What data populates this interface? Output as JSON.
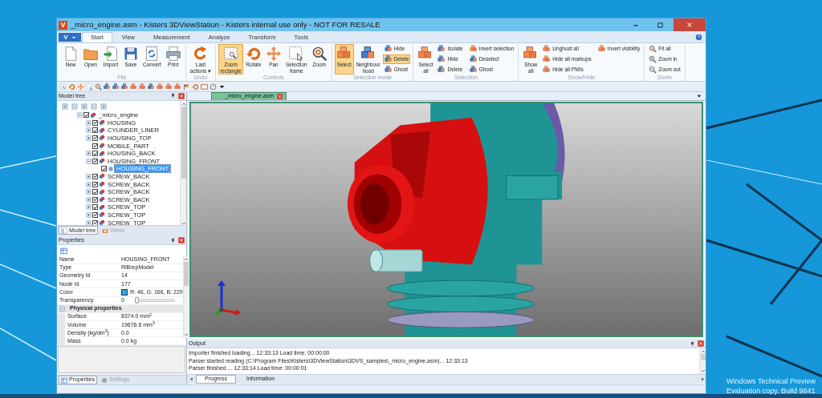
{
  "window": {
    "logo": "V",
    "title": "_micro_engine.asm - Kisters 3DViewStation - Kisters internal use only - NOT FOR RESALE"
  },
  "ribbon": {
    "app_button": "V",
    "tabs": [
      {
        "label": "Start",
        "selected": true
      },
      {
        "label": "View",
        "selected": false
      },
      {
        "label": "Measurement",
        "selected": false
      },
      {
        "label": "Analyze",
        "selected": false
      },
      {
        "label": "Transform",
        "selected": false
      },
      {
        "label": "Tools",
        "selected": false
      }
    ],
    "groups": [
      {
        "label": "File",
        "buttons": [
          {
            "label": "New",
            "kind": "large",
            "selected": false
          },
          {
            "label": "Open",
            "kind": "large",
            "selected": false
          },
          {
            "label": "Import",
            "kind": "large",
            "selected": false
          },
          {
            "label": "Save",
            "kind": "large",
            "selected": false
          },
          {
            "label": "Convert",
            "kind": "large",
            "selected": false
          },
          {
            "label": "Print",
            "kind": "large",
            "selected": false
          }
        ]
      },
      {
        "label": "Undo",
        "buttons": [
          {
            "label": "Last\nactions ▾",
            "kind": "large",
            "selected": false
          }
        ]
      },
      {
        "label": "Controls",
        "buttons": [
          {
            "label": "Zoom\nrectangle",
            "kind": "large",
            "selected": true
          },
          {
            "label": "Rotate",
            "kind": "large",
            "selected": false
          },
          {
            "label": "Pan",
            "kind": "large",
            "selected": false
          },
          {
            "label": "Selection\nframe",
            "kind": "large",
            "selected": false
          },
          {
            "label": "Zoom",
            "kind": "large",
            "selected": false
          }
        ]
      },
      {
        "label": "Selection mode",
        "buttons": [
          {
            "label": "Select",
            "kind": "large",
            "selected": true
          },
          {
            "label": "Neighbour\nhood",
            "kind": "large",
            "selected": false
          },
          {
            "label": "Hide",
            "kind": "small",
            "selected": false
          },
          {
            "label": "Delete",
            "kind": "small",
            "selected": true
          },
          {
            "label": "Ghost",
            "kind": "small",
            "selected": false
          }
        ]
      },
      {
        "label": "Selection",
        "buttons": [
          {
            "label": "Select\nall",
            "kind": "large",
            "selected": false
          },
          {
            "label": "Isolate",
            "kind": "small",
            "selected": false
          },
          {
            "label": "Hide",
            "kind": "small",
            "selected": false
          },
          {
            "label": "Delete",
            "kind": "small",
            "selected": false
          },
          {
            "label": "Invert selection",
            "kind": "small",
            "selected": false
          },
          {
            "label": "Deselect",
            "kind": "small",
            "selected": false
          },
          {
            "label": "Ghost",
            "kind": "small",
            "selected": false
          }
        ]
      },
      {
        "label": "Show/Hide",
        "buttons": [
          {
            "label": "Show\nall",
            "kind": "large",
            "selected": false
          },
          {
            "label": "Unghost all",
            "kind": "small",
            "selected": false
          },
          {
            "label": "Hide all markups",
            "kind": "small",
            "selected": false
          },
          {
            "label": "Hide all PMIs",
            "kind": "small",
            "selected": false
          },
          {
            "label": "Invert visibility",
            "kind": "small",
            "selected": false
          }
        ]
      },
      {
        "label": "Zoom",
        "buttons": [
          {
            "label": "Fit all",
            "kind": "small",
            "selected": false
          },
          {
            "label": "Zoom in",
            "kind": "small",
            "selected": false
          },
          {
            "label": "Zoom out",
            "kind": "small",
            "selected": false
          }
        ]
      }
    ]
  },
  "model_tree": {
    "title": "Model tree",
    "items": [
      {
        "label": "_micro_engine",
        "kind": "assembly",
        "checked": true,
        "selected": false,
        "expanded": true,
        "children": [
          {
            "label": "HOUSING",
            "kind": "assembly",
            "checked": true,
            "selected": false,
            "expanded": false
          },
          {
            "label": "CYLINDER_LINER",
            "kind": "assembly",
            "checked": true,
            "selected": false,
            "expanded": false
          },
          {
            "label": "HOUSING_TOP",
            "kind": "assembly",
            "checked": true,
            "selected": false,
            "expanded": false
          },
          {
            "label": "MOBILE_PART",
            "kind": "assembly",
            "checked": true,
            "selected": false
          },
          {
            "label": "HOUSING_BACK",
            "kind": "assembly",
            "checked": true,
            "selected": false,
            "expanded": false
          },
          {
            "label": "HOUSING_FRONT",
            "kind": "assembly",
            "checked": true,
            "selected": false,
            "expanded": true,
            "children": [
              {
                "label": "HOUSING_FRONT",
                "kind": "body",
                "checked": true,
                "selected": true
              }
            ]
          },
          {
            "label": "SCREW_BACK",
            "kind": "assembly",
            "checked": true,
            "selected": false,
            "expanded": false
          },
          {
            "label": "SCREW_BACK",
            "kind": "assembly",
            "checked": true,
            "selected": false,
            "expanded": false
          },
          {
            "label": "SCREW_BACK",
            "kind": "assembly",
            "checked": true,
            "selected": false,
            "expanded": false
          },
          {
            "label": "SCREW_BACK",
            "kind": "assembly",
            "checked": true,
            "selected": false,
            "expanded": false
          },
          {
            "label": "SCREW_TOP",
            "kind": "assembly",
            "checked": true,
            "selected": false,
            "expanded": false
          },
          {
            "label": "SCREW_TOP",
            "kind": "assembly",
            "checked": true,
            "selected": false,
            "expanded": false
          },
          {
            "label": "SCREW_TOP",
            "kind": "assembly",
            "checked": true,
            "selected": false,
            "expanded": false
          }
        ]
      }
    ],
    "tabs": [
      {
        "label": "Model tree",
        "selected": true
      },
      {
        "label": "Views",
        "selected": false
      }
    ]
  },
  "properties": {
    "title": "Properties",
    "rows": [
      {
        "kind": "field",
        "name": "Name",
        "value": "HOUSING_FRONT"
      },
      {
        "kind": "field",
        "name": "Type",
        "value": "RiBrepModel"
      },
      {
        "kind": "field",
        "name": "Geometry Id",
        "value": "14"
      },
      {
        "kind": "field",
        "name": "Node Id",
        "value": "177"
      },
      {
        "kind": "color",
        "name": "Color",
        "value": "R: 46, G: 166, B: 229",
        "color": "#2ea6e5"
      },
      {
        "kind": "slider",
        "name": "Transparency",
        "value": "0",
        "level": 0
      },
      {
        "kind": "group",
        "name": "Physical properties",
        "expanded": true,
        "children": [
          {
            "kind": "field",
            "name": "Surface",
            "value": "8374.0 mm$^{2}$"
          },
          {
            "kind": "field",
            "name": "Volume",
            "value": "19676.6 mm$^{3}$"
          },
          {
            "kind": "field",
            "name": "Density (kg/dm$^{3}$)",
            "value": "0.0"
          },
          {
            "kind": "field",
            "name": "Mass",
            "value": "0.0 kg"
          }
        ]
      }
    ],
    "tabs": [
      {
        "label": "Properties",
        "selected": true
      },
      {
        "label": "Settings",
        "selected": false
      }
    ]
  },
  "document_tab": {
    "label": "_micro_engine.asm"
  },
  "output": {
    "title": "Output",
    "lines": [
      "Importer finished loading... 12:33:13 Load time: 00:00:00",
      "Parser started reading (C:\\Program Files\\Kisters\\3DViewStation\\3DVS_samples\\_micro_engine.asm)... 12:33:13",
      "Parser finished ... 12:33:14 Load time: 00:00:01"
    ],
    "tabs": [
      {
        "label": "Progress",
        "selected": true
      },
      {
        "label": "Information",
        "selected": false
      }
    ]
  },
  "desktop": {
    "notice": [
      "Windows Technical Preview",
      "Evaluation copy. Build 9841"
    ]
  }
}
